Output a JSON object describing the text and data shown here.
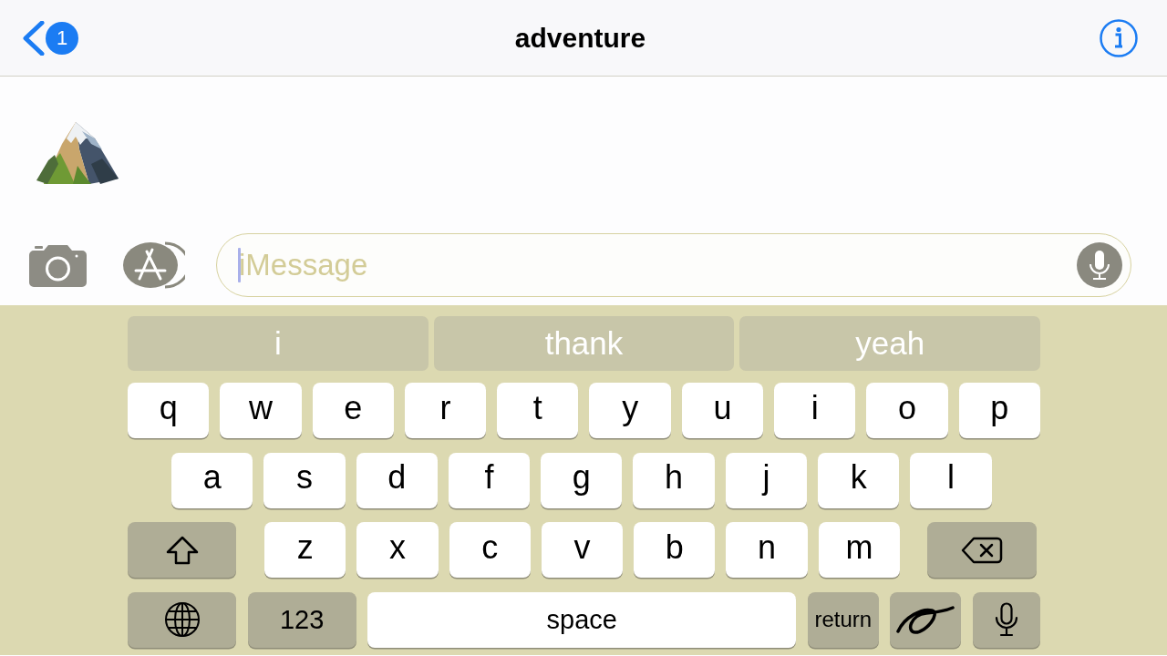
{
  "header": {
    "back_badge": "1",
    "title": "adventure"
  },
  "messages": [
    {
      "kind": "emoji"
    }
  ],
  "composer": {
    "placeholder": "iMessage",
    "focused": true
  },
  "suggestions": [
    "i",
    "thank",
    "yeah"
  ],
  "keyboard": {
    "rows": [
      {
        "keys": [
          {
            "kind": "letter",
            "label": "q"
          },
          {
            "kind": "letter",
            "label": "w"
          },
          {
            "kind": "letter",
            "label": "e"
          },
          {
            "kind": "letter",
            "label": "r"
          },
          {
            "kind": "letter",
            "label": "t"
          },
          {
            "kind": "letter",
            "label": "y"
          },
          {
            "kind": "letter",
            "label": "u"
          },
          {
            "kind": "letter",
            "label": "i"
          },
          {
            "kind": "letter",
            "label": "o"
          },
          {
            "kind": "letter",
            "label": "p"
          }
        ]
      },
      {
        "keys": [
          {
            "kind": "letter",
            "label": "a"
          },
          {
            "kind": "letter",
            "label": "s"
          },
          {
            "kind": "letter",
            "label": "d"
          },
          {
            "kind": "letter",
            "label": "f"
          },
          {
            "kind": "letter",
            "label": "g"
          },
          {
            "kind": "letter",
            "label": "h"
          },
          {
            "kind": "letter",
            "label": "j"
          },
          {
            "kind": "letter",
            "label": "k"
          },
          {
            "kind": "letter",
            "label": "l"
          }
        ]
      },
      {
        "keys": [
          {
            "kind": "shift"
          },
          {
            "kind": "letter",
            "label": "z"
          },
          {
            "kind": "letter",
            "label": "x"
          },
          {
            "kind": "letter",
            "label": "c"
          },
          {
            "kind": "letter",
            "label": "v"
          },
          {
            "kind": "letter",
            "label": "b"
          },
          {
            "kind": "letter",
            "label": "n"
          },
          {
            "kind": "letter",
            "label": "m"
          },
          {
            "kind": "delete"
          }
        ]
      },
      {
        "keys": [
          {
            "kind": "globe"
          },
          {
            "kind": "function",
            "label": "123"
          },
          {
            "kind": "space",
            "label": "space"
          },
          {
            "kind": "function",
            "label": "return"
          },
          {
            "kind": "handwriting"
          },
          {
            "kind": "dictation"
          }
        ]
      }
    ]
  }
}
